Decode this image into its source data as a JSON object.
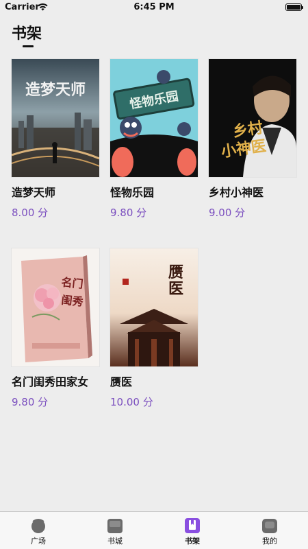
{
  "status": {
    "carrier": "Carrier",
    "time": "6:45 PM"
  },
  "page": {
    "title": "书架"
  },
  "books": [
    {
      "title": "造梦天师",
      "score": "8.00 分"
    },
    {
      "title": "怪物乐园",
      "score": "9.80 分"
    },
    {
      "title": "乡村小神医",
      "score": "9.00 分"
    },
    {
      "title": "名门闺秀田家女",
      "score": "9.80 分"
    },
    {
      "title": "赝医",
      "score": "10.00 分"
    }
  ],
  "tabs": [
    {
      "label": "广场",
      "icon": "plaza-icon"
    },
    {
      "label": "书城",
      "icon": "bookstore-icon"
    },
    {
      "label": "书架",
      "icon": "bookshelf-icon",
      "active": true
    },
    {
      "label": "我的",
      "icon": "profile-icon"
    }
  ],
  "colors": {
    "accent": "#7b4fbf",
    "active_tab": "#8a4fe0"
  }
}
